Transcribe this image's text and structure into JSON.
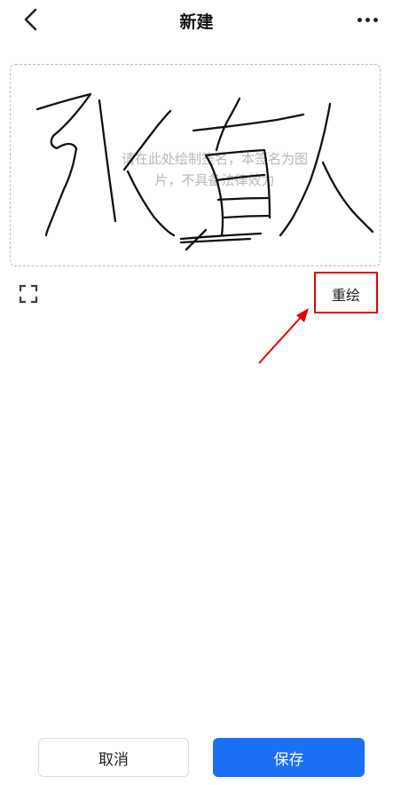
{
  "header": {
    "title": "新建",
    "back_icon": "chevron-left-icon",
    "more_icon": "more-horizontal-icon"
  },
  "signature_pad": {
    "placeholder_line1": "请在此处绘制签名，本签名为图",
    "placeholder_line2": "片，不具备法律效力",
    "signature_text": "张真人"
  },
  "toolbar": {
    "fullscreen_icon": "fullscreen-icon",
    "redraw_label": "重绘"
  },
  "annotation": {
    "highlight_color": "#e60000",
    "arrow_icon": "red-arrow-icon"
  },
  "footer": {
    "cancel_label": "取消",
    "save_label": "保存",
    "save_color": "#1a6ff5"
  }
}
